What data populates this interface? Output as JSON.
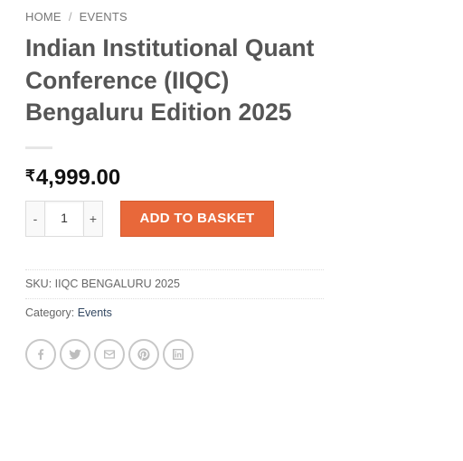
{
  "breadcrumb": {
    "home": "HOME",
    "separator": "/",
    "current": "EVENTS"
  },
  "product": {
    "title_line1": "Indian Institutional Quant",
    "title_line2": "Conference (IIQC)",
    "title_line3": "Bengaluru Edition 2025",
    "currency_symbol": "₹",
    "price": "4,999.00"
  },
  "cart": {
    "minus_label": "-",
    "quantity": "1",
    "plus_label": "+",
    "add_label": "ADD TO BASKET"
  },
  "meta": {
    "sku_label": "SKU:",
    "sku_value": "IIQC BENGALURU 2025",
    "category_label": "Category:",
    "category_value": "Events"
  },
  "share_icons": [
    "facebook-icon",
    "twitter-icon",
    "email-icon",
    "pinterest-icon",
    "linkedin-icon"
  ],
  "colors": {
    "accent": "#e8683a",
    "link": "#334862",
    "title": "#555555",
    "price": "#111111"
  }
}
